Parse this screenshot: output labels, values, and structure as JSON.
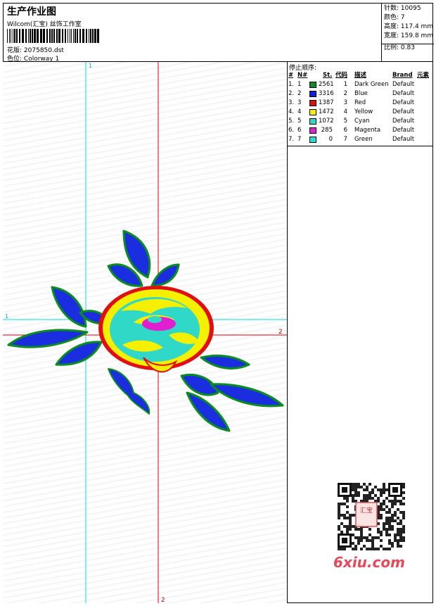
{
  "header": {
    "title": "生产作业图",
    "subtitle": "Wilcom(汇宝) 丝饰工作室",
    "design_file_label": "花版:",
    "design_file": "2075850.dst",
    "colorway_label": "色位:",
    "colorway": "Colorway 1"
  },
  "stats": {
    "stitches_label": "针数:",
    "stitches": "10095",
    "colors_label": "颜色:",
    "colors": "7",
    "height_label": "高度:",
    "height": "117.4 mm",
    "width_label": "宽度:",
    "width": "159.8 mm",
    "scale_label": "比例:",
    "scale": "0.83"
  },
  "guides": {
    "h1_label": "1",
    "h2_label": "2",
    "v1_label": "1",
    "v2_label": "2",
    "cyan": "#00e0e0",
    "red": "#e00000"
  },
  "stop_sequence": {
    "title": "停止顺序:",
    "columns": {
      "idx": "#",
      "no": "N#",
      "st": "St.",
      "code": "代码",
      "desc": "描述",
      "brand": "Brand",
      "elem": "元素"
    },
    "rows": [
      {
        "idx": "1.",
        "no": "1",
        "color": "#0a8c1e",
        "st": "2561",
        "code": "1",
        "desc": "Dark Green",
        "brand": "Default"
      },
      {
        "idx": "2.",
        "no": "2",
        "color": "#1020e0",
        "st": "3316",
        "code": "2",
        "desc": "Blue",
        "brand": "Default"
      },
      {
        "idx": "3.",
        "no": "3",
        "color": "#e01010",
        "st": "1387",
        "code": "3",
        "desc": "Red",
        "brand": "Default"
      },
      {
        "idx": "4.",
        "no": "4",
        "color": "#f4f000",
        "st": "1472",
        "code": "4",
        "desc": "Yellow",
        "brand": "Default"
      },
      {
        "idx": "5.",
        "no": "5",
        "color": "#30d8c8",
        "st": "1072",
        "code": "5",
        "desc": "Cyan",
        "brand": "Default"
      },
      {
        "idx": "6.",
        "no": "6",
        "color": "#e020d0",
        "st": "285",
        "code": "6",
        "desc": "Magenta",
        "brand": "Default"
      },
      {
        "idx": "7.",
        "no": "7",
        "color": "#20e0d0",
        "st": "0",
        "code": "7",
        "desc": "Green",
        "brand": "Default"
      }
    ]
  },
  "watermark": {
    "logo_text": "6xiu.com",
    "seal_text": "汇宝"
  }
}
